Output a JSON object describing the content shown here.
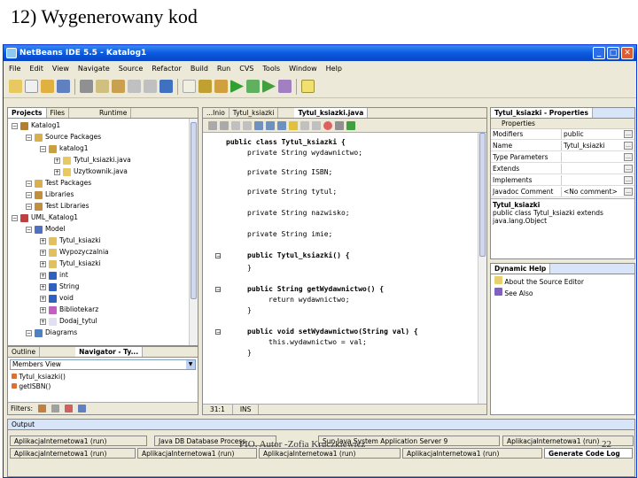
{
  "slide": {
    "title": "12)  Wygenerowany kod",
    "footer": "PIO. Autor -Zofia Kruczkiewicz",
    "page_number": "22"
  },
  "window": {
    "title": "NetBeans IDE 5.5 - Katalog1",
    "buttons": [
      "_",
      "□",
      "✕"
    ]
  },
  "menu": [
    "File",
    "Edit",
    "View",
    "Navigate",
    "Source",
    "Refactor",
    "Build",
    "Run",
    "CVS",
    "Tools",
    "Window",
    "Help"
  ],
  "projects": {
    "tabs": [
      "Projects",
      "Files",
      "Runtime"
    ],
    "items": [
      {
        "label": "Katalog1",
        "icon": "project-icon",
        "color": "#b08030",
        "indent": 0
      },
      {
        "label": "Source Packages",
        "icon": "folder-icon",
        "color": "#d8b050",
        "indent": 1
      },
      {
        "label": "katalog1",
        "icon": "package-icon",
        "color": "#c8a040",
        "indent": 2
      },
      {
        "label": "Tytul_ksiazki.java",
        "icon": "java-file-icon",
        "color": "#e8c860",
        "indent": 3
      },
      {
        "label": "Uzytkownik.java",
        "icon": "java-file-icon",
        "color": "#e8c860",
        "indent": 3
      },
      {
        "label": "Test Packages",
        "icon": "folder-icon",
        "color": "#d8b050",
        "indent": 1
      },
      {
        "label": "Libraries",
        "icon": "library-icon",
        "color": "#c09040",
        "indent": 1
      },
      {
        "label": "Test Libraries",
        "icon": "library-icon",
        "color": "#c09040",
        "indent": 1
      },
      {
        "label": "UML_Katalog1",
        "icon": "uml-project-icon",
        "color": "#c04040",
        "indent": 0
      },
      {
        "label": "Model",
        "icon": "model-icon",
        "color": "#5070c0",
        "indent": 1
      },
      {
        "label": "Tytul_ksiazki",
        "icon": "class-icon",
        "color": "#e0c060",
        "indent": 2
      },
      {
        "label": "Wypozyczalnia",
        "icon": "class-icon",
        "color": "#e0c060",
        "indent": 2
      },
      {
        "label": "Tytul_ksiazki",
        "icon": "class-icon",
        "color": "#e0c060",
        "indent": 2
      },
      {
        "label": "int",
        "icon": "datatype-icon",
        "color": "#3060c0",
        "indent": 2
      },
      {
        "label": "String",
        "icon": "datatype-icon",
        "color": "#3060c0",
        "indent": 2
      },
      {
        "label": "void",
        "icon": "datatype-icon",
        "color": "#3060c0",
        "indent": 2
      },
      {
        "label": "Bibliotekarz",
        "icon": "actor-icon",
        "color": "#c060c0",
        "indent": 2
      },
      {
        "label": "Dodaj_tytul",
        "icon": "usecase-icon",
        "color": "#e0e0f0",
        "indent": 2
      },
      {
        "label": "Diagrams",
        "icon": "diagram-icon",
        "color": "#5080c0",
        "indent": 1
      }
    ]
  },
  "navigator": {
    "tabs": [
      "Outline",
      "Navigator - Ty..."
    ],
    "combo": "Members View",
    "items": [
      "Tytul_ksiazki()",
      "getISBN()"
    ],
    "filters_label": "Filters:"
  },
  "editor": {
    "tabs": [
      "...Inio",
      "Tytul_ksiazki",
      "Tytul_ksiazki.java"
    ],
    "lines": [
      {
        "text": "public class Tytul_ksiazki {",
        "indent": 0
      },
      {
        "text": "private String wydawnictwo;",
        "indent": 1
      },
      {
        "text": "private String ISBN;",
        "indent": 1
      },
      {
        "text": "private String tytul;",
        "indent": 1
      },
      {
        "text": "private String nazwisko;",
        "indent": 1
      },
      {
        "text": "private String imie;",
        "indent": 1
      },
      {
        "text": "public Tytul_ksiazki() {",
        "indent": 1
      },
      {
        "text": "}",
        "indent": 1
      },
      {
        "text": "public String getWydawnictwo() {",
        "indent": 1
      },
      {
        "text": "return wydawnictwo;",
        "indent": 2
      },
      {
        "text": "}",
        "indent": 1
      },
      {
        "text": "public void setWydawnictwo(String val) {",
        "indent": 1
      },
      {
        "text": "this.wydawnictwo = val;",
        "indent": 2
      },
      {
        "text": "}",
        "indent": 1
      }
    ],
    "status_pos": "31:1",
    "status_mode": "INS"
  },
  "properties": {
    "title": "Tytul_ksiazki - Properties",
    "section": "Properties",
    "rows": [
      {
        "key": "Modifiers",
        "value": "public"
      },
      {
        "key": "Name",
        "value": "Tytul_ksiazki"
      },
      {
        "key": "Type Parameters",
        "value": ""
      },
      {
        "key": "Extends",
        "value": ""
      },
      {
        "key": "Implements",
        "value": ""
      },
      {
        "key": "Javadoc Comment",
        "value": "<No comment>"
      }
    ],
    "desc_title": "Tytul_ksiazki",
    "desc_text": "public class Tytul_ksiazki extends java.lang.Object"
  },
  "dynamic_help": {
    "title": "Dynamic Help",
    "items": [
      "About the Source Editor",
      "See Also"
    ]
  },
  "output": {
    "title": "Output",
    "row1": [
      "AplikacjaInternetowa1 (run)",
      "Java DB Database Process",
      "Sun Java System Application Server 9",
      "AplikacjaInternetowa1 (run)"
    ],
    "row2": [
      "AplikacjaInternetowa1 (run)",
      "AplikacjaInternetowa1 (run)",
      "AplikacjaInternetowa1 (run)",
      "AplikacjaInternetowa1 (run)",
      "Generate Code Log"
    ]
  }
}
